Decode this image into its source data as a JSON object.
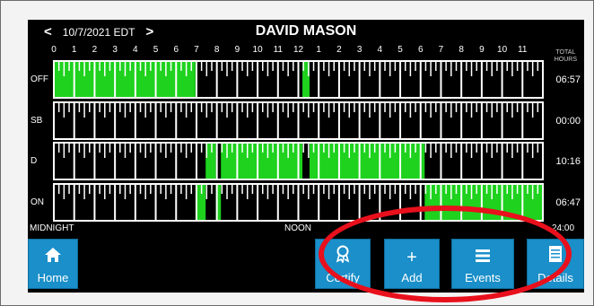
{
  "header": {
    "prev_icon": "chevron-left",
    "prev_glyph": "<",
    "date": "10/7/2021 EDT",
    "next_icon": "chevron-right",
    "next_glyph": ">",
    "driver_name": "DAVID MASON",
    "total_label_line1": "TOTAL",
    "total_label_line2": "HOURS"
  },
  "graph": {
    "hour_labels": [
      "0",
      "1",
      "2",
      "3",
      "4",
      "5",
      "6",
      "7",
      "8",
      "9",
      "10",
      "11",
      "12",
      "1",
      "2",
      "3",
      "4",
      "5",
      "6",
      "7",
      "8",
      "9",
      "10",
      "11"
    ],
    "rows": [
      {
        "label": "OFF",
        "total": "06:57"
      },
      {
        "label": "SB",
        "total": "00:00"
      },
      {
        "label": "D",
        "total": "10:16"
      },
      {
        "label": "ON",
        "total": "06:47"
      }
    ],
    "bottom_left": "MIDNIGHT",
    "bottom_mid": "NOON",
    "bottom_right": "24:00",
    "segments": [
      {
        "row": 0,
        "start": 0,
        "end": 6.95
      },
      {
        "row": 0,
        "start": 12.2,
        "end": 12.55
      },
      {
        "row": 3,
        "start": 6.95,
        "end": 7.45
      },
      {
        "row": 2,
        "start": 7.45,
        "end": 7.95
      },
      {
        "row": 3,
        "start": 7.95,
        "end": 8.2
      },
      {
        "row": 2,
        "start": 8.2,
        "end": 12.2
      },
      {
        "row": 2,
        "start": 12.55,
        "end": 18.2
      },
      {
        "row": 3,
        "start": 18.2,
        "end": 24
      }
    ],
    "active_color": "#1ed21e"
  },
  "buttons": {
    "home": {
      "label": "Home",
      "icon": "home-icon",
      "glyph": "🏠"
    },
    "certify": {
      "label": "Certify",
      "icon": "certify-ribbon-icon",
      "glyph": "🎗"
    },
    "add": {
      "label": "Add",
      "icon": "plus-icon",
      "glyph": "+"
    },
    "events": {
      "label": "Events",
      "icon": "list-icon",
      "glyph": "☰"
    },
    "details": {
      "label": "Details",
      "icon": "document-icon",
      "glyph": "▤"
    }
  }
}
